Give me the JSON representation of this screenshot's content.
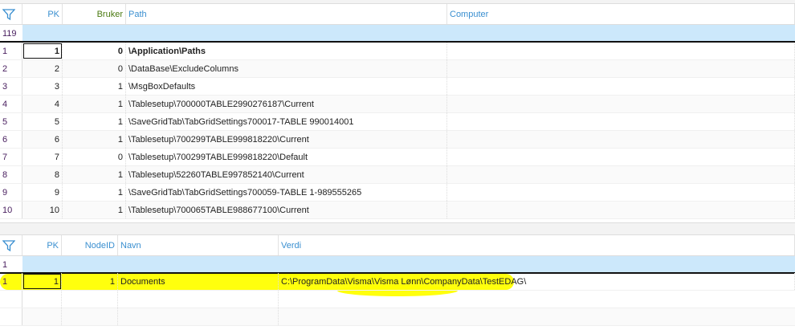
{
  "top_grid": {
    "columns": [
      "PK",
      "Bruker",
      "Path",
      "Computer"
    ],
    "filter_count": "119",
    "rows": [
      {
        "n": "1",
        "pk": "1",
        "bruker": "0",
        "path": "\\Application\\Paths",
        "computer": ""
      },
      {
        "n": "2",
        "pk": "2",
        "bruker": "0",
        "path": "\\DataBase\\ExcludeColumns",
        "computer": ""
      },
      {
        "n": "3",
        "pk": "3",
        "bruker": "1",
        "path": "\\MsgBoxDefaults",
        "computer": ""
      },
      {
        "n": "4",
        "pk": "4",
        "bruker": "1",
        "path": "\\Tablesetup\\700000TABLE2990276187\\Current",
        "computer": ""
      },
      {
        "n": "5",
        "pk": "5",
        "bruker": "1",
        "path": "\\SaveGridTab\\TabGridSettings700017-TABLE 990014001",
        "computer": ""
      },
      {
        "n": "6",
        "pk": "6",
        "bruker": "1",
        "path": "\\Tablesetup\\700299TABLE999818220\\Current",
        "computer": ""
      },
      {
        "n": "7",
        "pk": "7",
        "bruker": "0",
        "path": "\\Tablesetup\\700299TABLE999818220\\Default",
        "computer": ""
      },
      {
        "n": "8",
        "pk": "8",
        "bruker": "1",
        "path": "\\Tablesetup\\52260TABLE997852140\\Current",
        "computer": ""
      },
      {
        "n": "9",
        "pk": "9",
        "bruker": "1",
        "path": "\\SaveGridTab\\TabGridSettings700059-TABLE 1-989555265",
        "computer": ""
      },
      {
        "n": "10",
        "pk": "10",
        "bruker": "1",
        "path": "\\Tablesetup\\700065TABLE988677100\\Current",
        "computer": ""
      }
    ]
  },
  "bottom_grid": {
    "columns": [
      "PK",
      "NodeID",
      "Navn",
      "Verdi"
    ],
    "filter_count": "1",
    "rows": [
      {
        "n": "1",
        "pk": "1",
        "nodeid": "1",
        "navn": "Documents",
        "verdi": "C:\\ProgramData\\Visma\\Visma Lønn\\CompanyData\\TestEDAG\\"
      }
    ]
  },
  "colors": {
    "header_text": "#3a8fd0",
    "filter_bg": "#cce8fb",
    "highlight": "#ffff00"
  }
}
